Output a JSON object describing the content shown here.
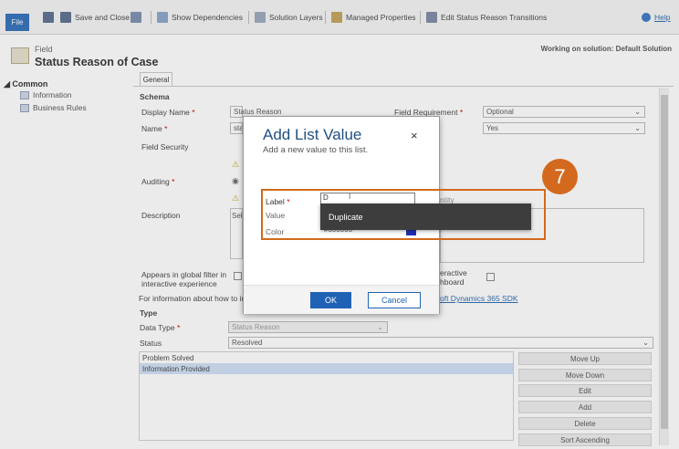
{
  "ribbon": {
    "file": "File",
    "save_and_close": "Save and Close",
    "show_dependencies": "Show Dependencies",
    "solution_layers": "Solution Layers",
    "managed_properties": "Managed Properties",
    "edit_status_reason_transitions": "Edit Status Reason Transitions",
    "help": "Help"
  },
  "header": {
    "entity_label": "Field",
    "title": "Status Reason of Case",
    "working_on": "Working on solution: Default Solution"
  },
  "nav": {
    "section": "Common",
    "items": [
      "Information",
      "Business Rules"
    ]
  },
  "tabs": [
    "General"
  ],
  "form": {
    "schema_heading": "Schema",
    "display_name_label": "Display Name",
    "display_name_value": "Status Reason",
    "name_label": "Name",
    "name_value": "sta",
    "field_requirement_label": "Field Requirement",
    "field_requirement_value": "Optional",
    "second_select_value": "Yes",
    "field_security_label": "Field Security",
    "auditing_label": "Auditing",
    "description_label": "Description",
    "description_value": "Sel",
    "right_partial_label": "ntity",
    "appears_global_label": "Appears in global filter in interactive experience",
    "interactive_dashboard_label": "eractive\nhboard",
    "info_text": "For information about how to in",
    "info_link": "oft Dynamics 365 SDK",
    "type_heading": "Type",
    "data_type_label": "Data Type",
    "data_type_value": "Status Reason",
    "status_label": "Status",
    "status_value": "Resolved"
  },
  "status_options": [
    "Problem Solved",
    "Information Provided"
  ],
  "side_buttons": [
    "Move Up",
    "Move Down",
    "Edit",
    "Add",
    "Delete",
    "Sort Ascending"
  ],
  "dialog": {
    "title": "Add List Value",
    "subtitle": "Add a new value to this list.",
    "close": "×",
    "label_field": "Label",
    "value_field": "Value",
    "color_field": "Color",
    "label_input": "D",
    "color_input": "#000000",
    "ok": "OK",
    "cancel": "Cancel"
  },
  "tooltip": {
    "text": "Duplicate"
  },
  "step_badge": "7",
  "colors": {
    "accent": "#1f62b5",
    "highlight": "#d26a1b",
    "badge": "#d2691e"
  }
}
